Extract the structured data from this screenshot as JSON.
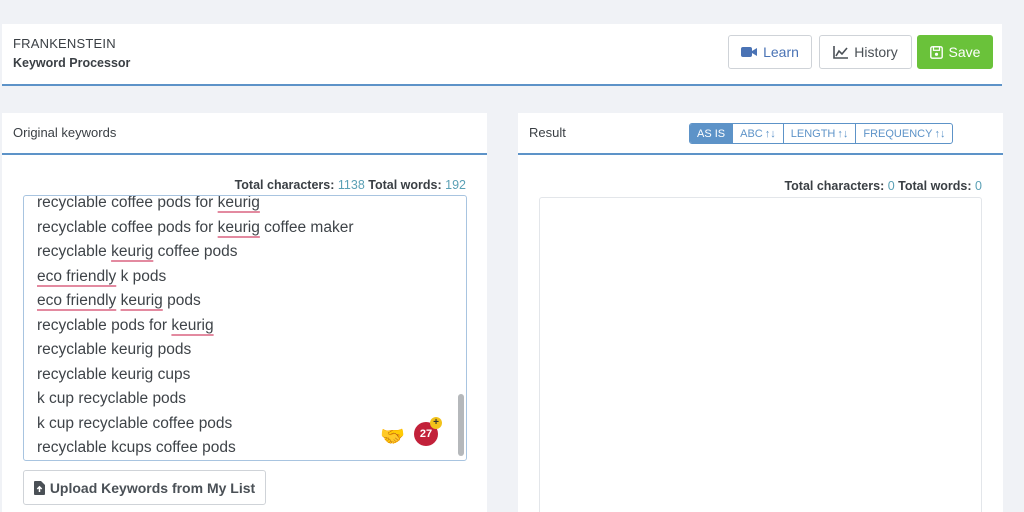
{
  "header": {
    "app_name": "FRANKENSTEIN",
    "app_subtitle": "Keyword Processor",
    "buttons": {
      "learn": "Learn",
      "history": "History",
      "save": "Save"
    }
  },
  "left_panel": {
    "title": "Original keywords",
    "stats": {
      "chars_label": "Total characters:",
      "chars_value": "1138",
      "words_label": "Total words:",
      "words_value": "192"
    },
    "keywords": [
      "recyclable coffee pods for keurig",
      "recyclable coffee pods for keurig coffee maker",
      "recyclable keurig coffee pods",
      "eco friendly k pods",
      "eco friendly keurig pods",
      "recyclable pods for keurig",
      "recyclable keurig pods",
      "recyclable keurig cups",
      "k cup recyclable pods",
      "k cup recyclable coffee pods",
      "recyclable kcups coffee pods"
    ],
    "badge_count": "27",
    "upload_button": "Upload Keywords from My List"
  },
  "right_panel": {
    "title": "Result",
    "sort_options": [
      {
        "label": "AS IS",
        "active": true
      },
      {
        "label": "ABC",
        "arrows": "↑↓"
      },
      {
        "label": "LENGTH",
        "arrows": "↑↓"
      },
      {
        "label": "FREQUENCY",
        "arrows": "↑↓"
      }
    ],
    "stats": {
      "chars_label": "Total characters:",
      "chars_value": "0",
      "words_label": "Total words:",
      "words_value": "0"
    }
  },
  "colors": {
    "accent": "#5d93c8",
    "save": "#6ac23a",
    "badge": "#c2213a",
    "stat_number": "#5aa0b5",
    "spellcheck_underline": "#e38aa0"
  },
  "icons": {
    "learn": "video-camera-icon",
    "history": "line-chart-icon",
    "save": "floppy-disk-icon",
    "upload": "file-upload-icon",
    "handshake": "handshake-icon"
  }
}
